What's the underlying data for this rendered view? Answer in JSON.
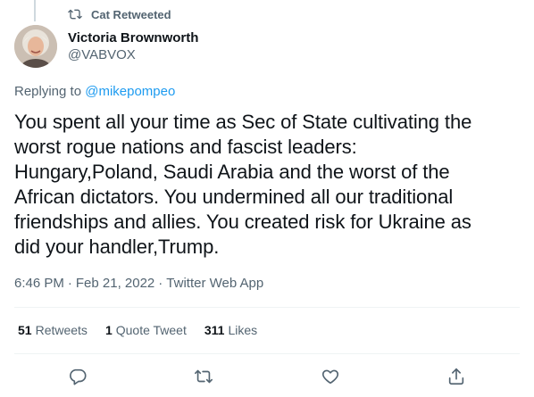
{
  "retweet_header": {
    "label": "Cat Retweeted",
    "icon": "retweet-icon"
  },
  "author": {
    "name": "Victoria Brownworth",
    "handle": "@VABVOX"
  },
  "replying": {
    "prefix": "Replying to",
    "target": "@mikepompeo"
  },
  "tweet": {
    "lines": [
      "You spent all your time as Sec of State cultivating the",
      "worst rogue nations and fascist leaders:",
      "Hungary,Poland, Saudi Arabia and the worst of the",
      "African dictators. You undermined all our traditional",
      "friendships and allies. You created risk for Ukraine as",
      "did your handler,Trump."
    ]
  },
  "meta": {
    "time": "6:46 PM",
    "sep": "·",
    "date": "Feb 21, 2022",
    "client": "Twitter Web App"
  },
  "stats": {
    "retweets": {
      "count": "51",
      "label": "Retweets"
    },
    "quotes": {
      "count": "1",
      "label": "Quote Tweet"
    },
    "likes": {
      "count": "311",
      "label": "Likes"
    }
  },
  "actions": [
    "reply-icon",
    "retweet-icon",
    "like-icon",
    "share-icon"
  ],
  "colors": {
    "accent": "#1d9bf0",
    "secondary_text": "#536471",
    "primary_text": "#0f1419",
    "divider": "#eff3f4"
  }
}
